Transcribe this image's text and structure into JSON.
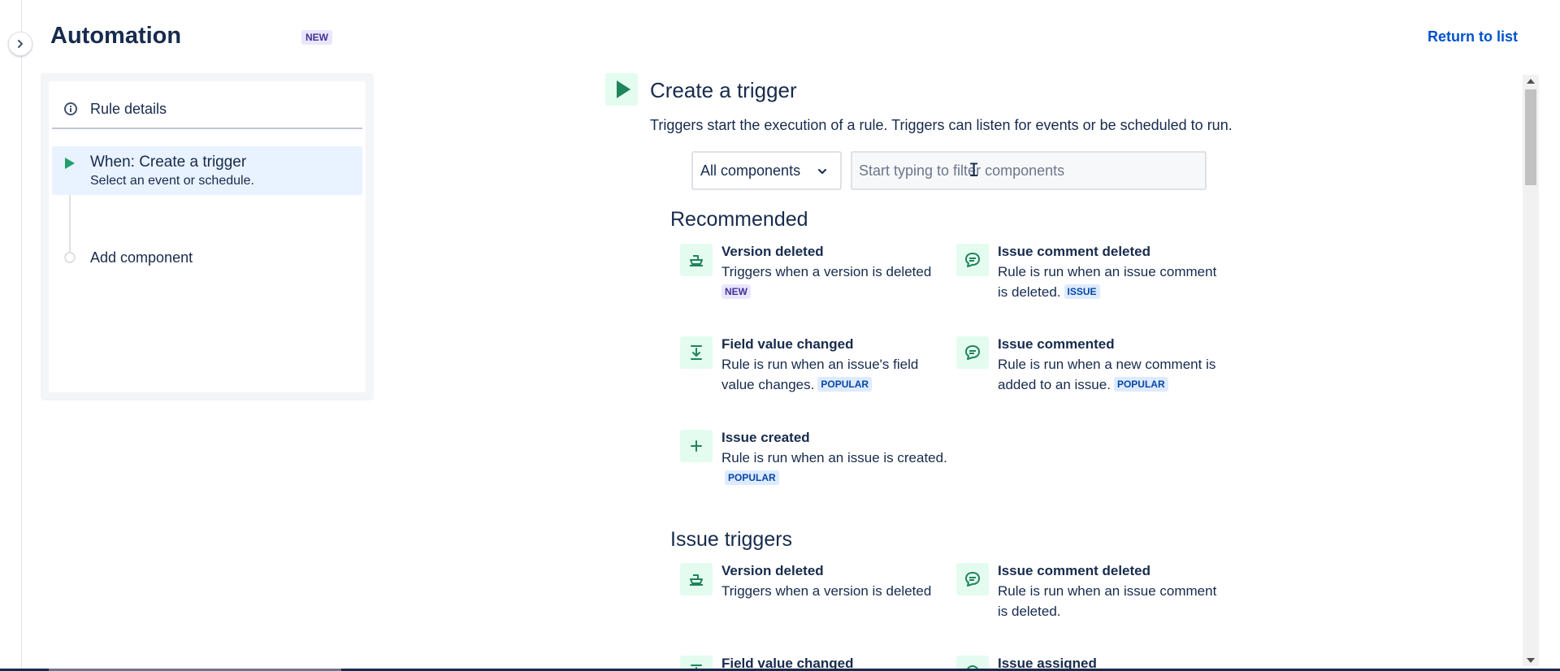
{
  "header": {
    "title": "Automation",
    "title_badge": "NEW",
    "return_link": "Return to list"
  },
  "sidebar": {
    "rule_details": "Rule details",
    "trigger_title": "When: Create a trigger",
    "trigger_subtitle": "Select an event or schedule.",
    "add_component": "Add component"
  },
  "main": {
    "heading": "Create a trigger",
    "description": "Triggers start the execution of a rule. Triggers can listen for events or be scheduled to run.",
    "filter_select_value": "All components",
    "filter_placeholder": "Start typing to filter components"
  },
  "recommended": {
    "title": "Recommended",
    "items": [
      {
        "icon": "ship-icon",
        "title": "Version deleted",
        "description": "Triggers when a version is deleted",
        "badge": "NEW"
      },
      {
        "icon": "comment-icon",
        "title": "Issue comment deleted",
        "description": "Rule is run when an issue comment is deleted.",
        "badge": "ISSUE"
      },
      {
        "icon": "field-change-icon",
        "title": "Field value changed",
        "description": "Rule is run when an issue's field value changes.",
        "badge": "POPULAR"
      },
      {
        "icon": "comment-icon",
        "title": "Issue commented",
        "description": "Rule is run when a new comment is added to an issue.",
        "badge": "POPULAR"
      },
      {
        "icon": "plus-icon",
        "title": "Issue created",
        "description": "Rule is run when an issue is created.",
        "badge": "POPULAR"
      }
    ]
  },
  "issue_triggers": {
    "title": "Issue triggers",
    "items": [
      {
        "icon": "ship-icon",
        "title": "Version deleted",
        "description": "Triggers when a version is deleted"
      },
      {
        "icon": "comment-icon",
        "title": "Issue comment deleted",
        "description": "Rule is run when an issue comment is deleted."
      },
      {
        "icon": "field-change-icon",
        "title": "Field value changed"
      },
      {
        "icon": "assign-icon",
        "title": "Issue assigned"
      }
    ]
  },
  "colors": {
    "accent_green": "#1f845a",
    "icon_bg": "#e3fcef",
    "link_blue": "#0052cc",
    "selected_bg": "#e9f2ff"
  }
}
